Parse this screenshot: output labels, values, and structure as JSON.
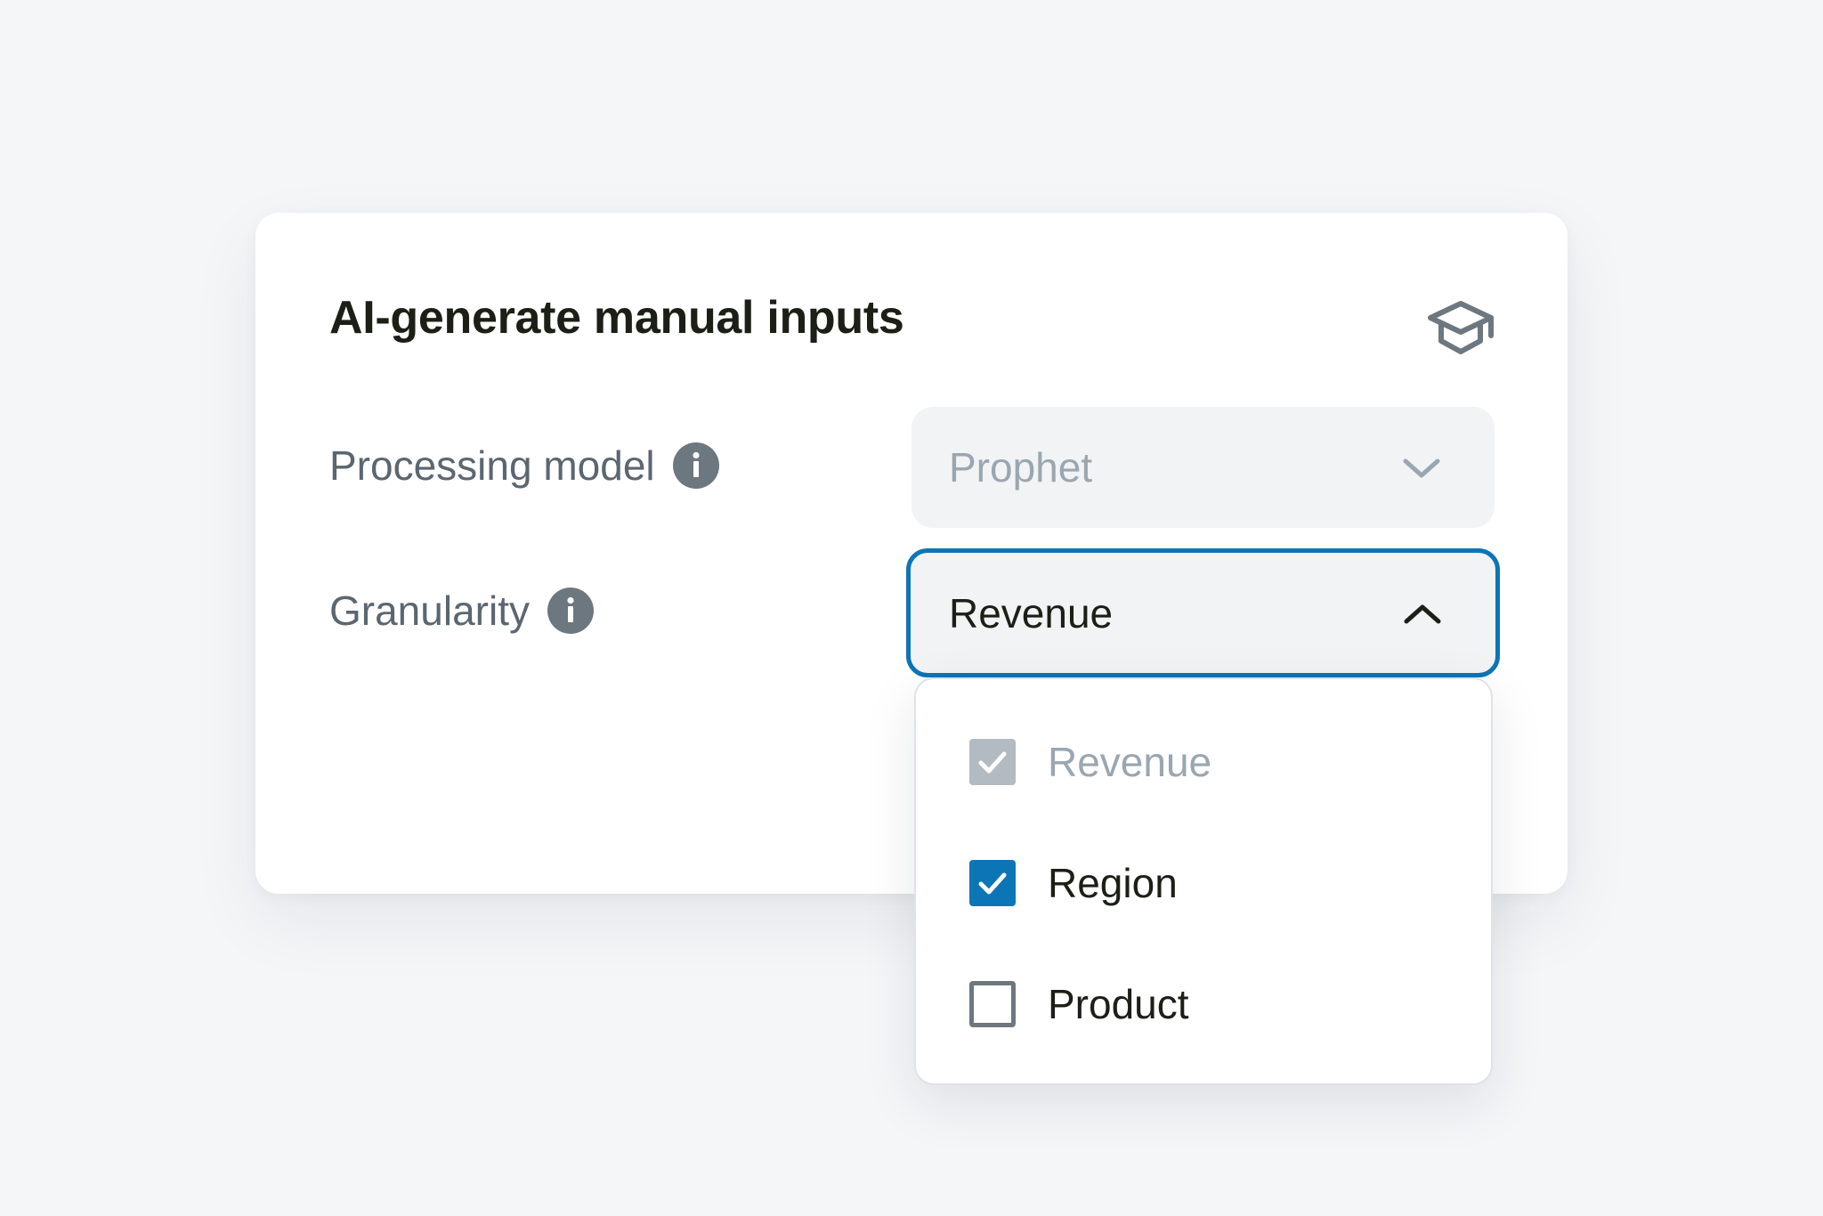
{
  "card": {
    "title": "AI-generate manual inputs",
    "learn_icon": "graduation-cap-icon"
  },
  "fields": {
    "processing_model": {
      "label": "Processing model",
      "info_icon": "info-icon",
      "value": "Prophet",
      "state": "disabled"
    },
    "granularity": {
      "label": "Granularity",
      "info_icon": "info-icon",
      "value": "Revenue",
      "state": "open"
    }
  },
  "dropdown": {
    "options": [
      {
        "label": "Revenue",
        "checked": true,
        "disabled": true
      },
      {
        "label": "Region",
        "checked": true,
        "disabled": false
      },
      {
        "label": "Product",
        "checked": false,
        "disabled": false
      }
    ]
  },
  "colors": {
    "background": "#f5f6f8",
    "card": "#ffffff",
    "accent": "#0c75b5",
    "title_text": "#1c1f16",
    "label_text": "#5b6670",
    "disabled_text": "#9aa6b0",
    "icon_gray": "#6d777f"
  }
}
